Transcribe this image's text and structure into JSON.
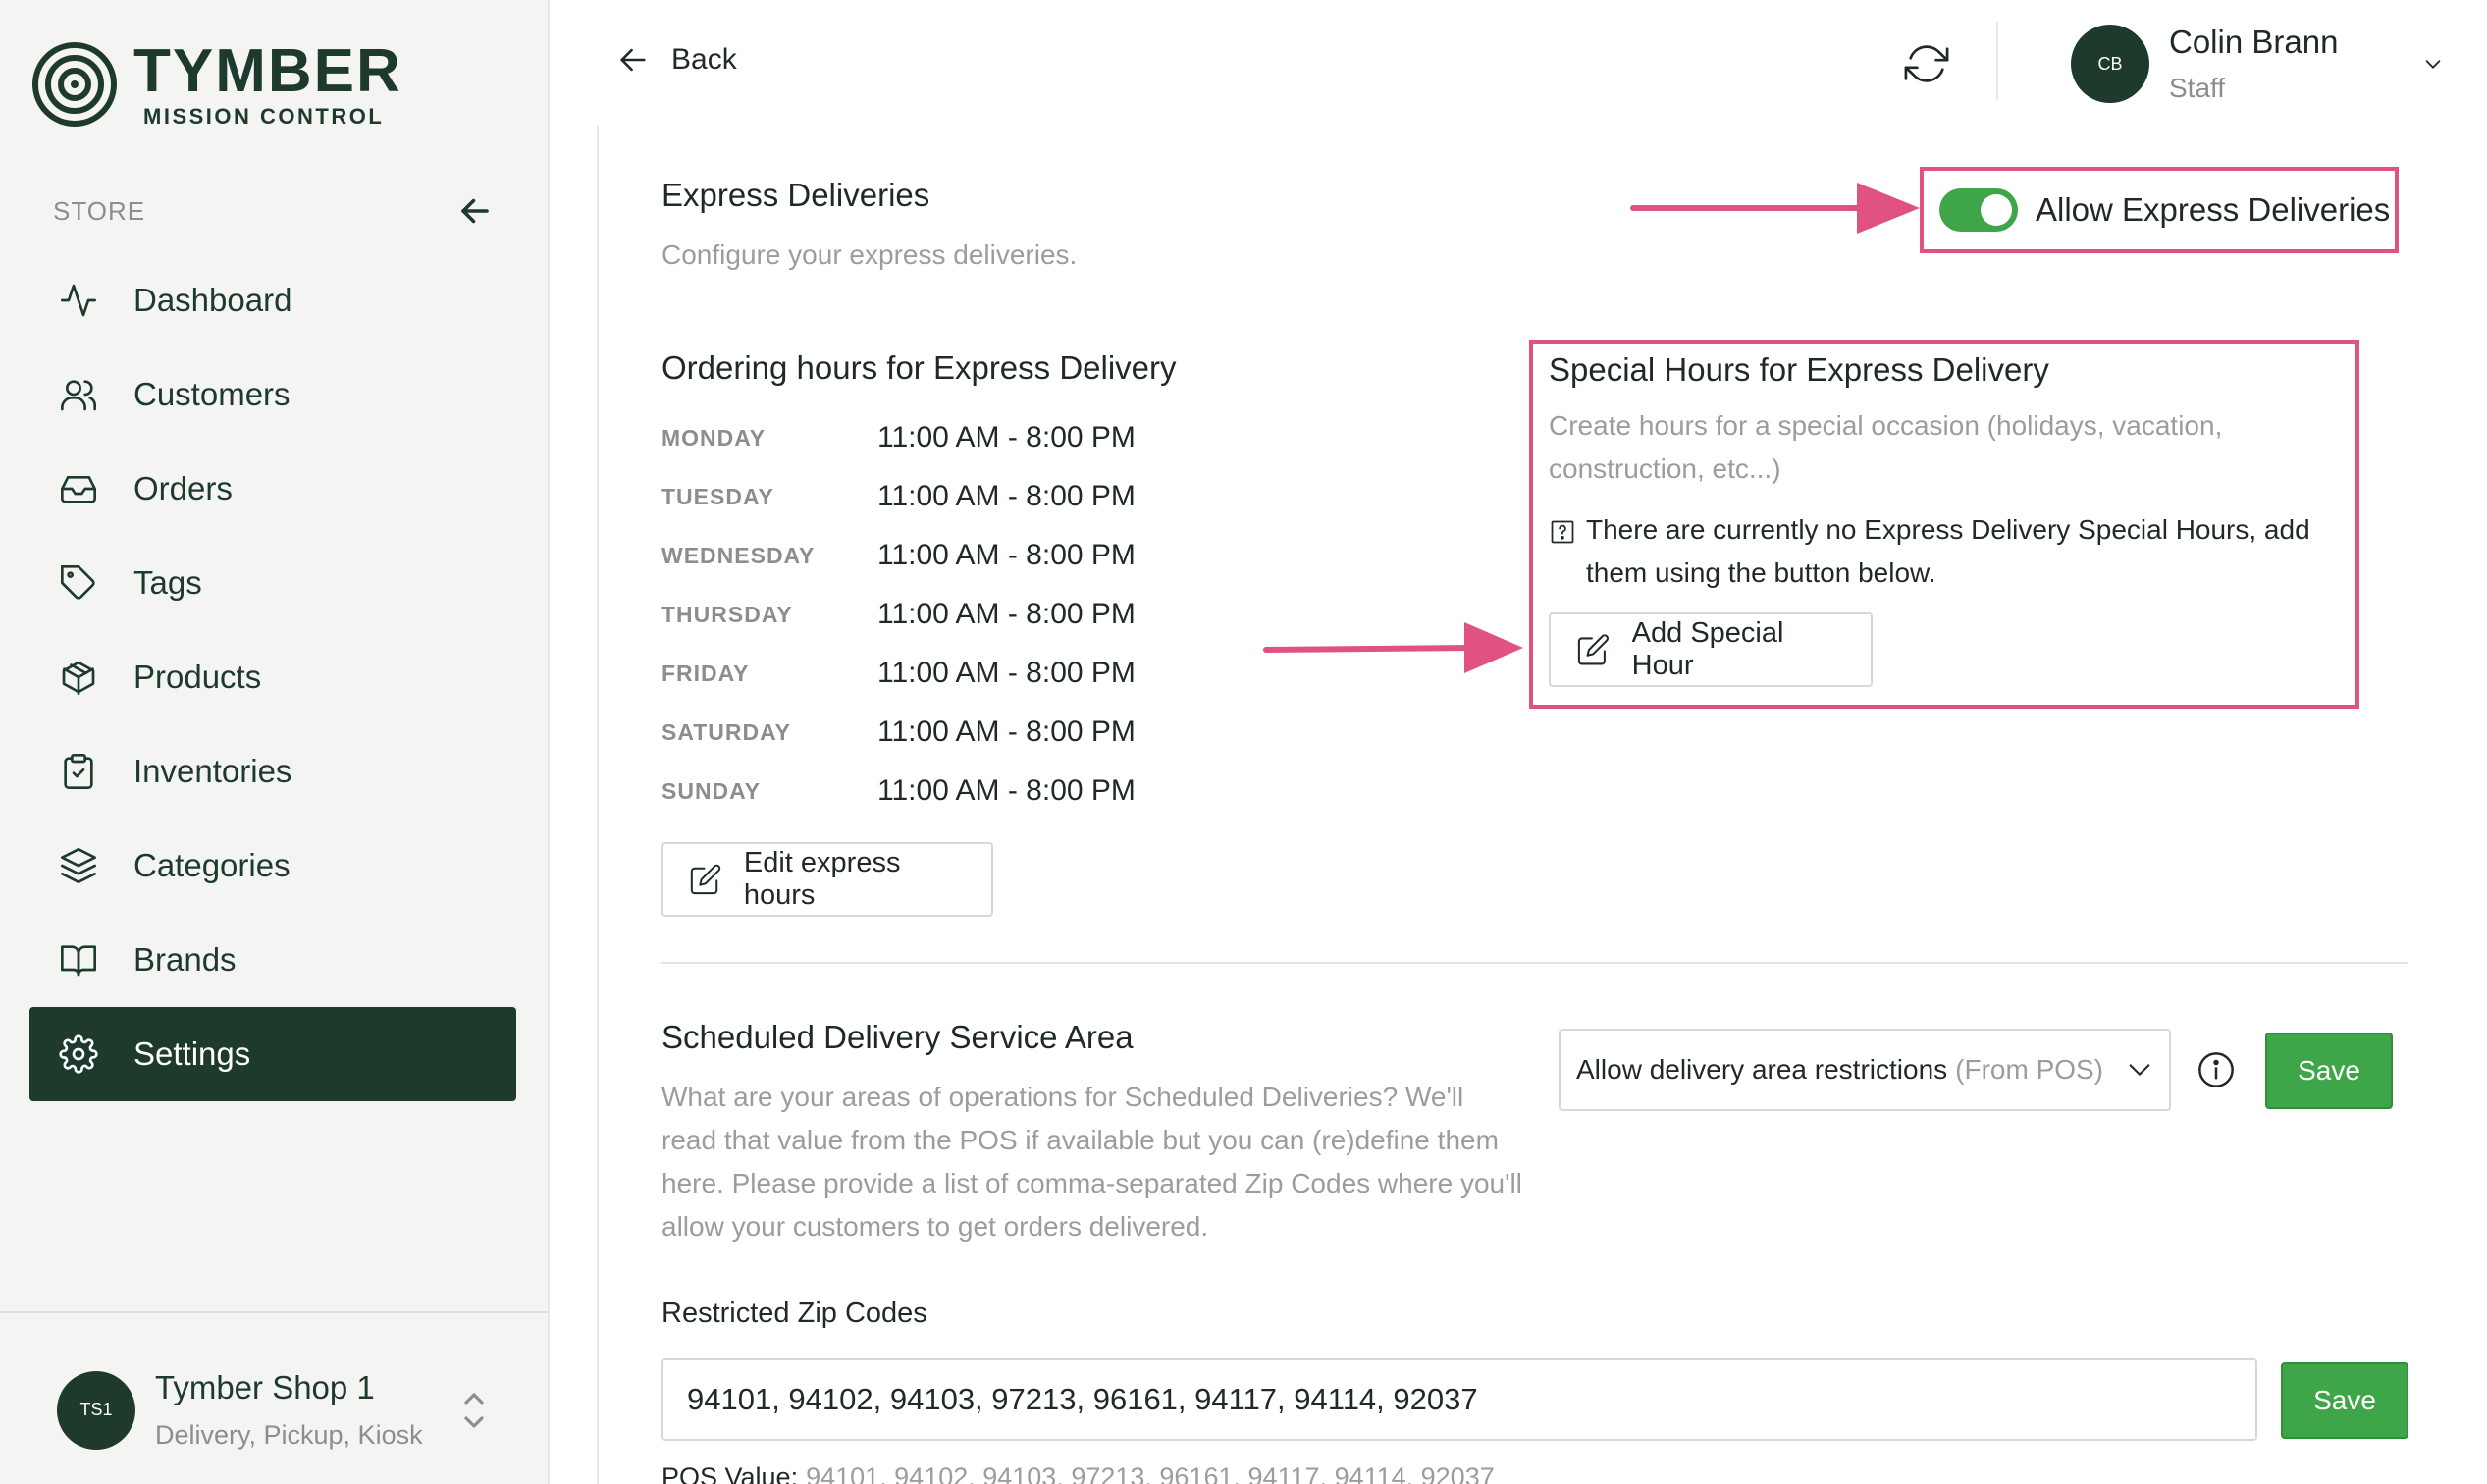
{
  "brand": {
    "title": "TYMBER",
    "subtitle": "MISSION CONTROL"
  },
  "sidebar": {
    "section_label": "STORE",
    "items": [
      {
        "label": "Dashboard",
        "icon": "activity-icon"
      },
      {
        "label": "Customers",
        "icon": "users-icon"
      },
      {
        "label": "Orders",
        "icon": "inbox-icon"
      },
      {
        "label": "Tags",
        "icon": "tag-icon"
      },
      {
        "label": "Products",
        "icon": "box-icon"
      },
      {
        "label": "Inventories",
        "icon": "clipboard-check-icon"
      },
      {
        "label": "Categories",
        "icon": "layers-icon"
      },
      {
        "label": "Brands",
        "icon": "book-icon"
      },
      {
        "label": "Settings",
        "icon": "gear-icon",
        "active": true
      }
    ],
    "shop": {
      "avatar": "TS1",
      "name": "Tymber Shop 1",
      "types": "Delivery, Pickup, Kiosk"
    }
  },
  "header": {
    "back_label": "Back",
    "user": {
      "initials": "CB",
      "name": "Colin Brann",
      "role": "Staff"
    }
  },
  "express": {
    "title": "Express Deliveries",
    "subtitle": "Configure your express deliveries.",
    "toggle_label": "Allow Express Deliveries",
    "toggle_on": true,
    "hours_title": "Ordering hours for Express Delivery",
    "hours": [
      {
        "day": "MONDAY",
        "time": "11:00 AM - 8:00 PM"
      },
      {
        "day": "TUESDAY",
        "time": "11:00 AM - 8:00 PM"
      },
      {
        "day": "WEDNESDAY",
        "time": "11:00 AM - 8:00 PM"
      },
      {
        "day": "THURSDAY",
        "time": "11:00 AM - 8:00 PM"
      },
      {
        "day": "FRIDAY",
        "time": "11:00 AM - 8:00 PM"
      },
      {
        "day": "SATURDAY",
        "time": "11:00 AM - 8:00 PM"
      },
      {
        "day": "SUNDAY",
        "time": "11:00 AM - 8:00 PM"
      }
    ],
    "edit_hours_label": "Edit express hours",
    "special": {
      "title": "Special Hours for Express Delivery",
      "subtitle": "Create hours for a special occasion (holidays, vacation, construction, etc...)",
      "empty_message": "There are currently no Express Delivery Special Hours, add them using the button below.",
      "add_label": "Add Special Hour"
    }
  },
  "scheduled": {
    "title": "Scheduled Delivery Service Area",
    "description": "What are your areas of operations for Scheduled Deliveries? We'll read that value from the POS if available but you can (re)define them here. Please provide a list of comma-separated Zip Codes where you'll allow your customers to get orders delivered.",
    "select_label": "Allow delivery area restrictions",
    "select_hint": "(From POS)",
    "save_label": "Save",
    "zip_label": "Restricted Zip Codes",
    "zip_value": "94101, 94102, 94103, 97213, 96161, 94117, 94114, 92037",
    "zip_save_label": "Save",
    "pos_label": "POS Value:",
    "pos_value": "94101, 94102, 94103, 97213, 96161, 94117, 94114, 92037"
  },
  "colors": {
    "brand_dark": "#1d3a2d",
    "accent_green": "#3ea648",
    "annotation_pink": "#e0527f",
    "sidebar_bg": "#f4f4f2"
  }
}
